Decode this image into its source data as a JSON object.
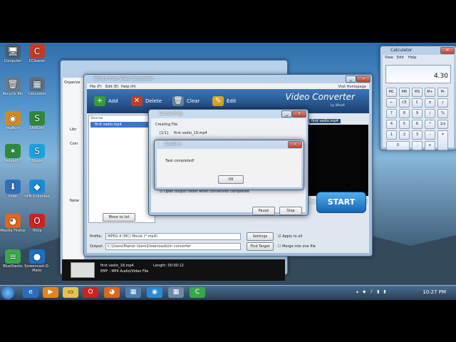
{
  "desktop_icons": [
    {
      "label": "Computer",
      "icon": "computer-icon",
      "color": "#4a5e74",
      "glyph": "🖥"
    },
    {
      "label": "CCleaner",
      "icon": "ccleaner-icon",
      "color": "#c43a2a",
      "glyph": "C"
    },
    {
      "label": "Recycle Bin",
      "icon": "recycle-bin-icon",
      "color": "#6b7a88",
      "glyph": "🗑"
    },
    {
      "label": "Calculator",
      "icon": "calculator-icon",
      "color": "#5d6f84",
      "glyph": "▦"
    },
    {
      "label": "ImgBurn",
      "icon": "imgburn-icon",
      "color": "#d48a1c",
      "glyph": "◉"
    },
    {
      "label": "SMADAV",
      "icon": "smadav-icon",
      "color": "#2d8a3a",
      "glyph": "S"
    },
    {
      "label": "Netspid...",
      "icon": "netspider-icon",
      "color": "#2c8a3a",
      "glyph": "✶"
    },
    {
      "label": "Skype",
      "icon": "skype-icon",
      "color": "#19a3e0",
      "glyph": "S"
    },
    {
      "label": "Orbit",
      "icon": "orbit-icon",
      "color": "#2e6fc0",
      "glyph": "⬇"
    },
    {
      "label": "VPN Unlimited",
      "icon": "vpn-icon",
      "color": "#1b8bd6",
      "glyph": "◆"
    },
    {
      "label": "Mozilla Firefox",
      "icon": "firefox-icon",
      "color": "#e2661b",
      "glyph": "◕"
    },
    {
      "label": "Tricia",
      "icon": "opera-icon",
      "color": "#d0221f",
      "glyph": "O"
    },
    {
      "label": "BlueStacks",
      "icon": "bluestacks-icon",
      "color": "#3aa64a",
      "glyph": "≡"
    },
    {
      "label": "Screencast-O-Matic",
      "icon": "screencast-icon",
      "color": "#1d6fc4",
      "glyph": "●"
    }
  ],
  "converter": {
    "title": "Winxo Free Video Converter",
    "menu": [
      "File (F)",
      "Edit (E)",
      "Help (H)"
    ],
    "menu_right": "Visit Homepage",
    "toolbar": [
      "Add",
      "Delete",
      "Clear",
      "Edit"
    ],
    "brand": "Video Converter",
    "brand_sub": "by iWisoft",
    "source_header": "Source",
    "source_file": "first vedio.mp4",
    "preview_label": "first vedio.mp4",
    "move_button": "Move to list",
    "profile_label": "Profile:",
    "profile_value": "MPEG-4 (MC) Movie (*.mp4)",
    "settings_button": "Settings",
    "apply_all": "Apply to all",
    "output_label": "Output:",
    "output_value": "C:\\Users\\Mamin Islam\\Downloads\\lin converter",
    "find_target": "Find Target",
    "merge": "Merge into one file",
    "start": "START"
  },
  "converting": {
    "title": "Converting",
    "creating": "Creating File",
    "progress": "[1/1]",
    "file": "first vedio_19.mp4",
    "open_output": "Open output folder when conversion completed",
    "pause": "Pause",
    "stop": "Stop"
  },
  "confirm": {
    "title": "Confirm",
    "message": "Task completed!",
    "ok": "OK"
  },
  "calculator": {
    "title": "Calculator",
    "menu": [
      "View",
      "Edit",
      "Help"
    ],
    "display": "4.30",
    "keys": [
      "MC",
      "MR",
      "MS",
      "M+",
      "M-",
      "←",
      "CE",
      "C",
      "±",
      "√",
      "7",
      "8",
      "9",
      "/",
      "%",
      "4",
      "5",
      "6",
      "*",
      "1/x",
      "1",
      "2",
      "3",
      "-",
      "=",
      "0",
      "",
      ".",
      "+",
      ""
    ]
  },
  "explorer": {
    "sidebar": [
      "Organize",
      "Libr",
      "Com",
      "Netw"
    ]
  },
  "thumb": {
    "name": "first vedio_18.mp4",
    "type": "EMF - MP4 Audio/Video File",
    "length": "Length: 00:00:12"
  },
  "taskbar": {
    "clock": "10:27 PM"
  }
}
